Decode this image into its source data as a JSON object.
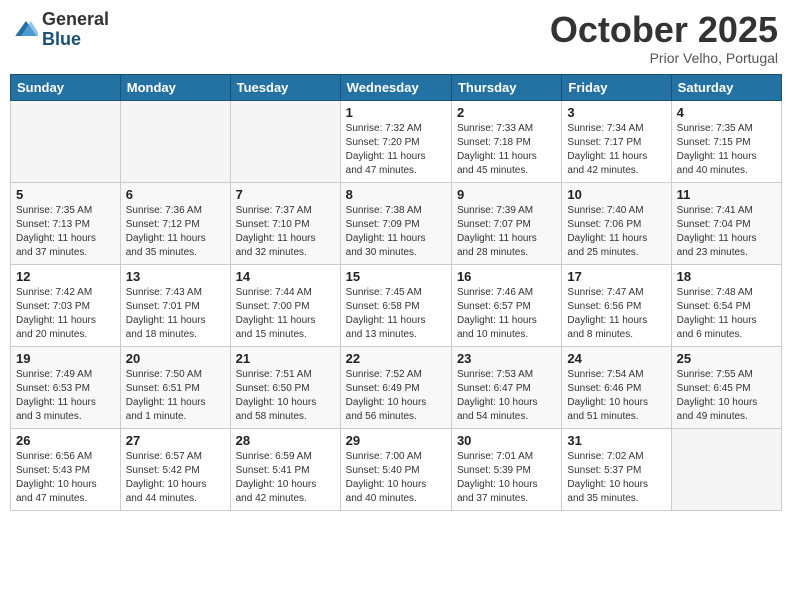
{
  "header": {
    "logo_general": "General",
    "logo_blue": "Blue",
    "month": "October 2025",
    "location": "Prior Velho, Portugal"
  },
  "weekdays": [
    "Sunday",
    "Monday",
    "Tuesday",
    "Wednesday",
    "Thursday",
    "Friday",
    "Saturday"
  ],
  "weeks": [
    [
      {
        "day": "",
        "info": ""
      },
      {
        "day": "",
        "info": ""
      },
      {
        "day": "",
        "info": ""
      },
      {
        "day": "1",
        "info": "Sunrise: 7:32 AM\nSunset: 7:20 PM\nDaylight: 11 hours\nand 47 minutes."
      },
      {
        "day": "2",
        "info": "Sunrise: 7:33 AM\nSunset: 7:18 PM\nDaylight: 11 hours\nand 45 minutes."
      },
      {
        "day": "3",
        "info": "Sunrise: 7:34 AM\nSunset: 7:17 PM\nDaylight: 11 hours\nand 42 minutes."
      },
      {
        "day": "4",
        "info": "Sunrise: 7:35 AM\nSunset: 7:15 PM\nDaylight: 11 hours\nand 40 minutes."
      }
    ],
    [
      {
        "day": "5",
        "info": "Sunrise: 7:35 AM\nSunset: 7:13 PM\nDaylight: 11 hours\nand 37 minutes."
      },
      {
        "day": "6",
        "info": "Sunrise: 7:36 AM\nSunset: 7:12 PM\nDaylight: 11 hours\nand 35 minutes."
      },
      {
        "day": "7",
        "info": "Sunrise: 7:37 AM\nSunset: 7:10 PM\nDaylight: 11 hours\nand 32 minutes."
      },
      {
        "day": "8",
        "info": "Sunrise: 7:38 AM\nSunset: 7:09 PM\nDaylight: 11 hours\nand 30 minutes."
      },
      {
        "day": "9",
        "info": "Sunrise: 7:39 AM\nSunset: 7:07 PM\nDaylight: 11 hours\nand 28 minutes."
      },
      {
        "day": "10",
        "info": "Sunrise: 7:40 AM\nSunset: 7:06 PM\nDaylight: 11 hours\nand 25 minutes."
      },
      {
        "day": "11",
        "info": "Sunrise: 7:41 AM\nSunset: 7:04 PM\nDaylight: 11 hours\nand 23 minutes."
      }
    ],
    [
      {
        "day": "12",
        "info": "Sunrise: 7:42 AM\nSunset: 7:03 PM\nDaylight: 11 hours\nand 20 minutes."
      },
      {
        "day": "13",
        "info": "Sunrise: 7:43 AM\nSunset: 7:01 PM\nDaylight: 11 hours\nand 18 minutes."
      },
      {
        "day": "14",
        "info": "Sunrise: 7:44 AM\nSunset: 7:00 PM\nDaylight: 11 hours\nand 15 minutes."
      },
      {
        "day": "15",
        "info": "Sunrise: 7:45 AM\nSunset: 6:58 PM\nDaylight: 11 hours\nand 13 minutes."
      },
      {
        "day": "16",
        "info": "Sunrise: 7:46 AM\nSunset: 6:57 PM\nDaylight: 11 hours\nand 10 minutes."
      },
      {
        "day": "17",
        "info": "Sunrise: 7:47 AM\nSunset: 6:56 PM\nDaylight: 11 hours\nand 8 minutes."
      },
      {
        "day": "18",
        "info": "Sunrise: 7:48 AM\nSunset: 6:54 PM\nDaylight: 11 hours\nand 6 minutes."
      }
    ],
    [
      {
        "day": "19",
        "info": "Sunrise: 7:49 AM\nSunset: 6:53 PM\nDaylight: 11 hours\nand 3 minutes."
      },
      {
        "day": "20",
        "info": "Sunrise: 7:50 AM\nSunset: 6:51 PM\nDaylight: 11 hours\nand 1 minute."
      },
      {
        "day": "21",
        "info": "Sunrise: 7:51 AM\nSunset: 6:50 PM\nDaylight: 10 hours\nand 58 minutes."
      },
      {
        "day": "22",
        "info": "Sunrise: 7:52 AM\nSunset: 6:49 PM\nDaylight: 10 hours\nand 56 minutes."
      },
      {
        "day": "23",
        "info": "Sunrise: 7:53 AM\nSunset: 6:47 PM\nDaylight: 10 hours\nand 54 minutes."
      },
      {
        "day": "24",
        "info": "Sunrise: 7:54 AM\nSunset: 6:46 PM\nDaylight: 10 hours\nand 51 minutes."
      },
      {
        "day": "25",
        "info": "Sunrise: 7:55 AM\nSunset: 6:45 PM\nDaylight: 10 hours\nand 49 minutes."
      }
    ],
    [
      {
        "day": "26",
        "info": "Sunrise: 6:56 AM\nSunset: 5:43 PM\nDaylight: 10 hours\nand 47 minutes."
      },
      {
        "day": "27",
        "info": "Sunrise: 6:57 AM\nSunset: 5:42 PM\nDaylight: 10 hours\nand 44 minutes."
      },
      {
        "day": "28",
        "info": "Sunrise: 6:59 AM\nSunset: 5:41 PM\nDaylight: 10 hours\nand 42 minutes."
      },
      {
        "day": "29",
        "info": "Sunrise: 7:00 AM\nSunset: 5:40 PM\nDaylight: 10 hours\nand 40 minutes."
      },
      {
        "day": "30",
        "info": "Sunrise: 7:01 AM\nSunset: 5:39 PM\nDaylight: 10 hours\nand 37 minutes."
      },
      {
        "day": "31",
        "info": "Sunrise: 7:02 AM\nSunset: 5:37 PM\nDaylight: 10 hours\nand 35 minutes."
      },
      {
        "day": "",
        "info": ""
      }
    ]
  ]
}
